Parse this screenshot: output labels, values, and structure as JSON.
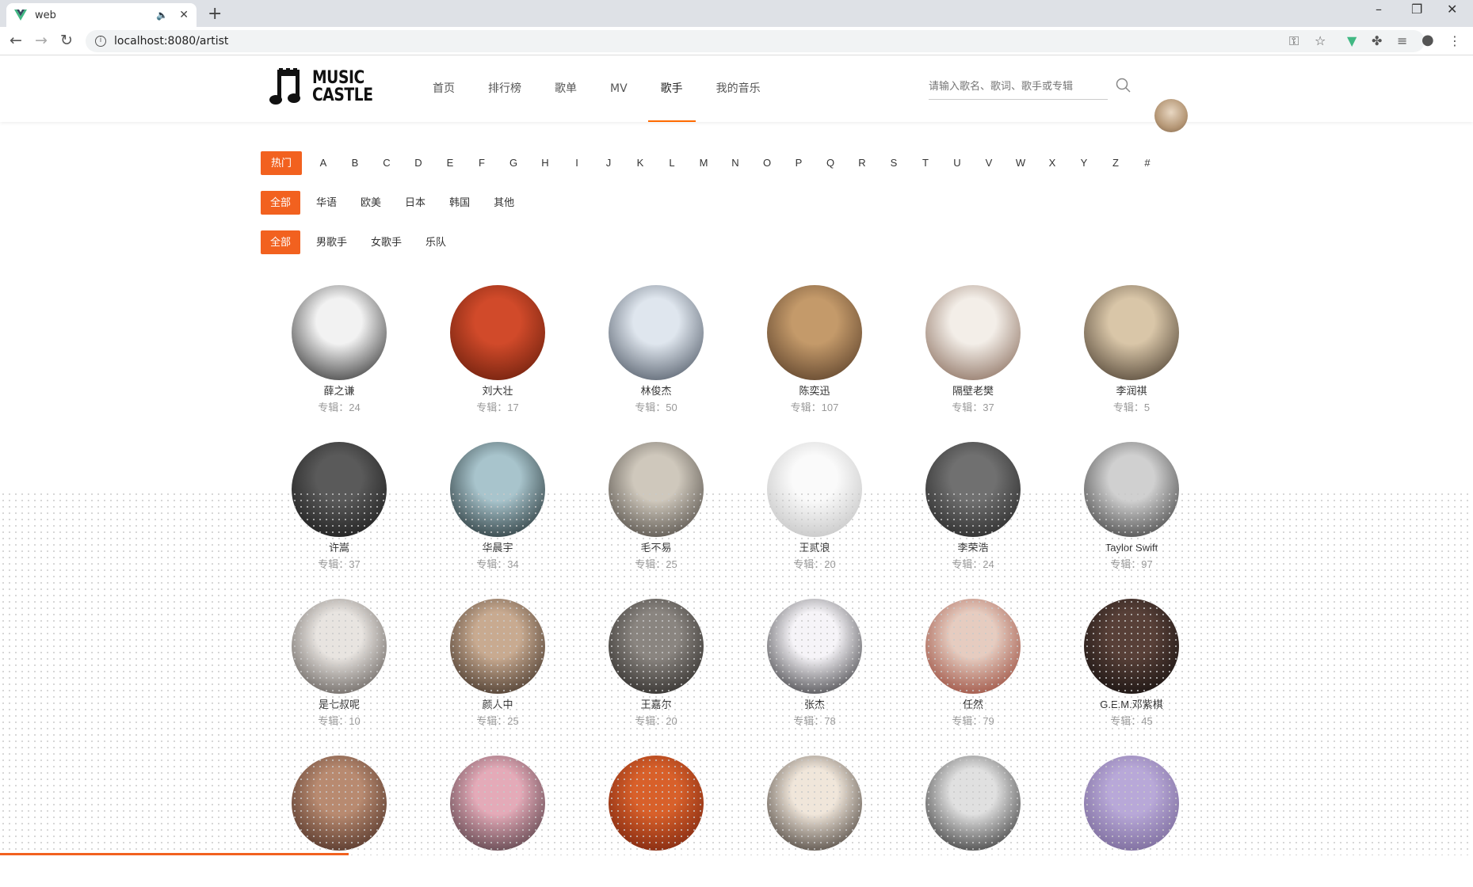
{
  "browser": {
    "tab_title": "web",
    "url": "localhost:8080/artist"
  },
  "site": {
    "logo_line1": "MUSIC",
    "logo_line2": "CASTLE",
    "nav": [
      "首页",
      "排行榜",
      "歌单",
      "MV",
      "歌手",
      "我的音乐"
    ],
    "active_nav": "歌手",
    "search_placeholder": "请输入歌名、歌词、歌手或专辑"
  },
  "filters": {
    "letters": [
      "热门",
      "A",
      "B",
      "C",
      "D",
      "E",
      "F",
      "G",
      "H",
      "I",
      "J",
      "K",
      "L",
      "M",
      "N",
      "O",
      "P",
      "Q",
      "R",
      "S",
      "T",
      "U",
      "V",
      "W",
      "X",
      "Y",
      "Z",
      "#"
    ],
    "regions": [
      "全部",
      "华语",
      "欧美",
      "日本",
      "韩国",
      "其他"
    ],
    "types": [
      "全部",
      "男歌手",
      "女歌手",
      "乐队"
    ]
  },
  "artists": [
    {
      "name": "薛之谦",
      "albums": "专辑：24",
      "c1": "#f2f2f2",
      "c2": "#1a1a1a"
    },
    {
      "name": "刘大壮",
      "albums": "专辑：17",
      "c1": "#d14a2a",
      "c2": "#5a1808"
    },
    {
      "name": "林俊杰",
      "albums": "专辑：50",
      "c1": "#dfe6ee",
      "c2": "#3a4452"
    },
    {
      "name": "陈奕迅",
      "albums": "专辑：107",
      "c1": "#c49a6a",
      "c2": "#4a3220"
    },
    {
      "name": "隔壁老樊",
      "albums": "专辑：37",
      "c1": "#f3eee8",
      "c2": "#7a5a48"
    },
    {
      "name": "李润祺",
      "albums": "专辑：5",
      "c1": "#d9c6a8",
      "c2": "#3a2e22"
    },
    {
      "name": "许嵩",
      "albums": "专辑：37",
      "c1": "#5a5a5a",
      "c2": "#101010"
    },
    {
      "name": "华晨宇",
      "albums": "专辑：34",
      "c1": "#a8c4cc",
      "c2": "#0e1a1c"
    },
    {
      "name": "毛不易",
      "albums": "专辑：25",
      "c1": "#cfc8bc",
      "c2": "#3a3530"
    },
    {
      "name": "王贰浪",
      "albums": "专辑：20",
      "c1": "#fafafa",
      "c2": "#b8b8b8"
    },
    {
      "name": "李荣浩",
      "albums": "专辑：24",
      "c1": "#707070",
      "c2": "#1a1a1a"
    },
    {
      "name": "Taylor Swift",
      "albums": "专辑：97",
      "c1": "#d0d0d0",
      "c2": "#2a2a2a"
    },
    {
      "name": "是七叔呢",
      "albums": "专辑：10",
      "c1": "#e8e4e0",
      "c2": "#4a4440"
    },
    {
      "name": "颜人中",
      "albums": "专辑：25",
      "c1": "#c8aa90",
      "c2": "#2a1e16"
    },
    {
      "name": "王嘉尔",
      "albums": "专辑：20",
      "c1": "#8a8580",
      "c2": "#1c1a18"
    },
    {
      "name": "张杰",
      "albums": "专辑：78",
      "c1": "#f6f4f8",
      "c2": "#202024"
    },
    {
      "name": "任然",
      "albums": "专辑：79",
      "c1": "#e6ccc0",
      "c2": "#8a3020"
    },
    {
      "name": "G.E.M.邓紫棋",
      "albums": "专辑：45",
      "c1": "#584038",
      "c2": "#0a0808"
    },
    {
      "name": "",
      "albums": "",
      "c1": "#b88a70",
      "c2": "#3a2018"
    },
    {
      "name": "",
      "albums": "",
      "c1": "#e4aab8",
      "c2": "#3a2a30"
    },
    {
      "name": "",
      "albums": "",
      "c1": "#d8602a",
      "c2": "#6a1a0a"
    },
    {
      "name": "",
      "albums": "",
      "c1": "#f0e6da",
      "c2": "#2a221c"
    },
    {
      "name": "",
      "albums": "",
      "c1": "#e0e0e0",
      "c2": "#1a1a1a"
    },
    {
      "name": "",
      "albums": "",
      "c1": "#b8a8d8",
      "c2": "#6a5a8a"
    }
  ],
  "colors": {
    "accent": "#f2611f"
  }
}
